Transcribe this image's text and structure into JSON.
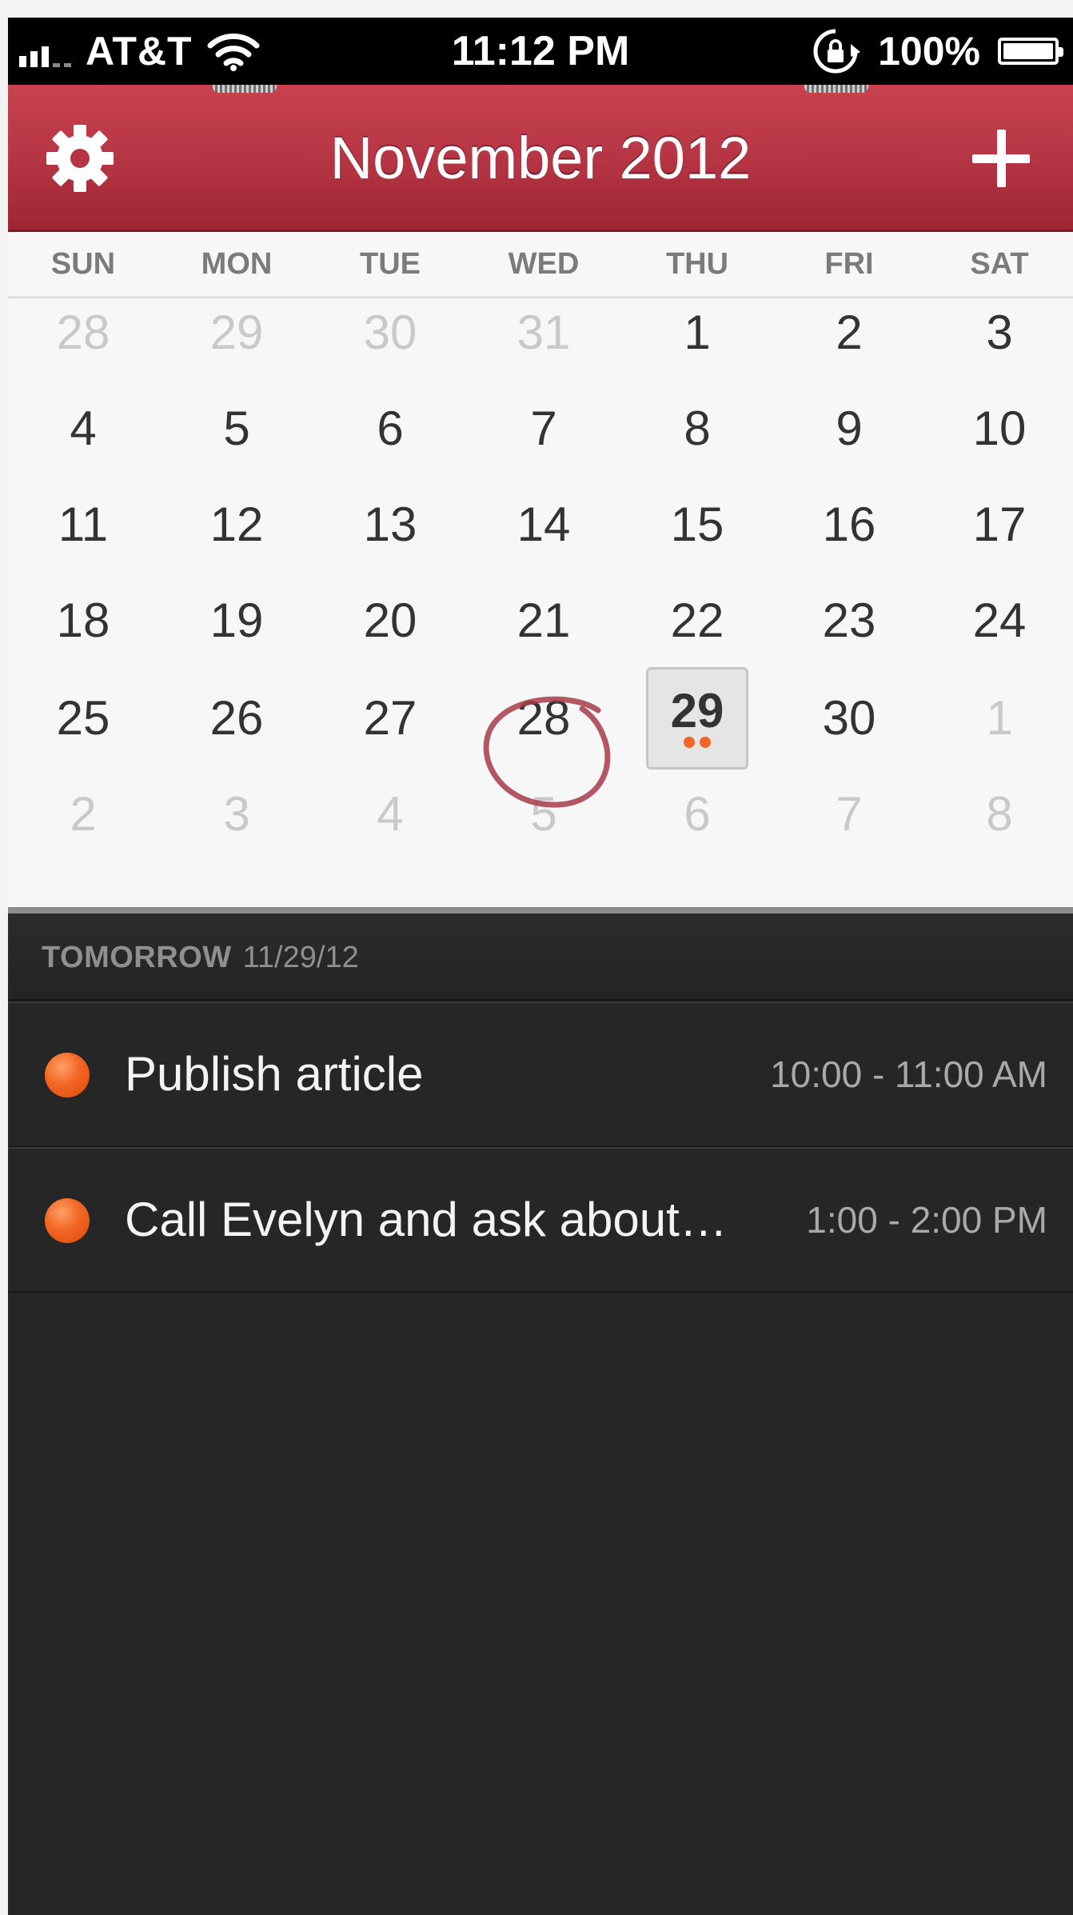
{
  "status_bar": {
    "carrier": "AT&T",
    "time": "11:12 PM",
    "battery_percent": "100%",
    "battery_level": 1.0,
    "icons": [
      "signal-icon",
      "wifi-icon",
      "rotation-lock-icon",
      "battery-icon"
    ]
  },
  "header": {
    "title": "November 2012",
    "settings_icon": "gear-icon",
    "add_icon": "plus-icon",
    "accent_color": "#b83746"
  },
  "calendar": {
    "weekdays": [
      "SUN",
      "MON",
      "TUE",
      "WED",
      "THU",
      "FRI",
      "SAT"
    ],
    "weeks": [
      [
        "28",
        "29",
        "30",
        "31",
        "1",
        "2",
        "3"
      ],
      [
        "4",
        "5",
        "6",
        "7",
        "8",
        "9",
        "10"
      ],
      [
        "11",
        "12",
        "13",
        "14",
        "15",
        "16",
        "17"
      ],
      [
        "18",
        "19",
        "20",
        "21",
        "22",
        "23",
        "24"
      ],
      [
        "25",
        "26",
        "27",
        "28",
        "29",
        "30",
        "1"
      ],
      [
        "2",
        "3",
        "4",
        "5",
        "6",
        "7",
        "8"
      ]
    ],
    "today": "28",
    "selected": "29",
    "selected_event_count": 2
  },
  "agenda": {
    "header_label": "TOMORROW",
    "header_date": "11/29/12",
    "events": [
      {
        "title": "Publish article",
        "time": "10:00 - 11:00 AM",
        "color": "#f26522"
      },
      {
        "title": "Call Evelyn and ask about…",
        "time": "1:00 - 2:00 PM",
        "color": "#f26522"
      }
    ]
  }
}
